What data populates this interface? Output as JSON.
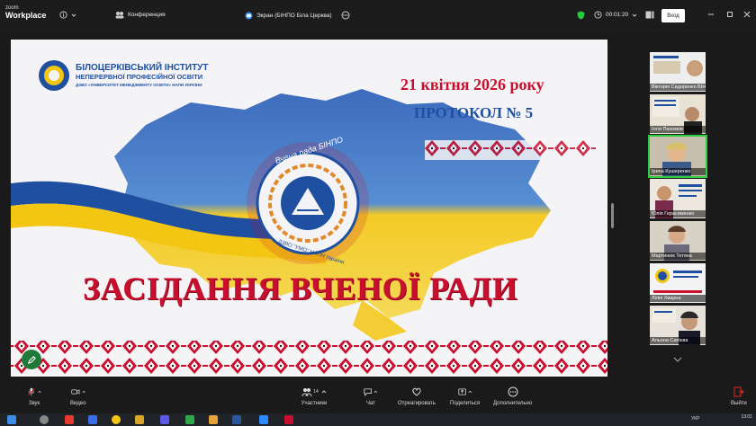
{
  "titlebar": {
    "brand_small": "zoom",
    "brand_main": "Workplace",
    "meeting_label": "Конференция",
    "share_label": "Экран (БІНПО Біла Церква)",
    "timer": "00:01:20",
    "signin_label": "Вход"
  },
  "slide": {
    "org_line1": "БІЛОЦЕРКІВСЬКИЙ ІНСТИТУТ",
    "org_line2": "НЕПЕРЕРВНОЇ ПРОФЕСІЙНОЇ ОСВІТИ",
    "org_line3": "ДЗВО «УНІВЕРСИТЕТ МЕНЕДЖМЕНТУ ОСВІТИ» НАПН УКРАЇНИ",
    "date": "21 квітня 2026 року",
    "protocol": "ПРОТОКОЛ № 5",
    "emblem_top": "Вчена рада БІНПО",
    "emblem_bottom": "ДЗВО \"УМО\" НАПН України",
    "headline": "ЗАСІДАННЯ ВЧЕНОЇ РАДИ"
  },
  "participants": [
    {
      "name": "Вікторія Сидоренко БІНП..."
    },
    {
      "name": "Ілля Пахомов"
    },
    {
      "name": "Ірина Кушеренко"
    },
    {
      "name": "Юлія Герасименко"
    },
    {
      "name": "Мартинюк Тетяна"
    },
    {
      "name": "Лілія Хварна"
    },
    {
      "name": "Альона Сапієва"
    }
  ],
  "toolbar": {
    "audio": "Звук",
    "video": "Видео",
    "participants": "Участники",
    "participants_count": "14",
    "chat": "Чат",
    "react": "Отреагировать",
    "share": "Поделиться",
    "more": "Дополнительно",
    "leave": "Выйти"
  },
  "taskbar": {
    "time": "13:01",
    "lang": "УКР"
  },
  "colors": {
    "blue": "#1f4fa0",
    "yellow": "#f3c613",
    "red": "#c8102e",
    "leave_red": "#e02828"
  }
}
